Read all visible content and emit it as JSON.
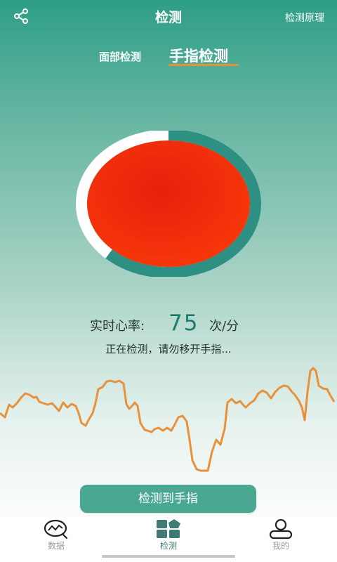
{
  "header": {
    "title": "检测",
    "principle_label": "检测原理"
  },
  "mode_tabs": [
    {
      "label": "面部检测",
      "active": false
    },
    {
      "label": "手指检测",
      "active": true
    }
  ],
  "measurement": {
    "heart_rate_label": "实时心率:",
    "heart_rate_value": "75",
    "heart_rate_unit": "次/分",
    "status_text": "正在检测，请勿移开手指...",
    "progress": 0.62
  },
  "colors": {
    "accent": "#2e9e86",
    "wave": "#e8913a",
    "camera_red": "#f02a0a",
    "progress_ring": "#2e8f83"
  },
  "detect_button": {
    "label": "检测到手指"
  },
  "bottom_nav": [
    {
      "label": "数据",
      "icon": "chart-bubble-icon",
      "active": false
    },
    {
      "label": "检测",
      "icon": "grid-detect-icon",
      "active": true
    },
    {
      "label": "我的",
      "icon": "person-icon",
      "active": false
    }
  ]
}
